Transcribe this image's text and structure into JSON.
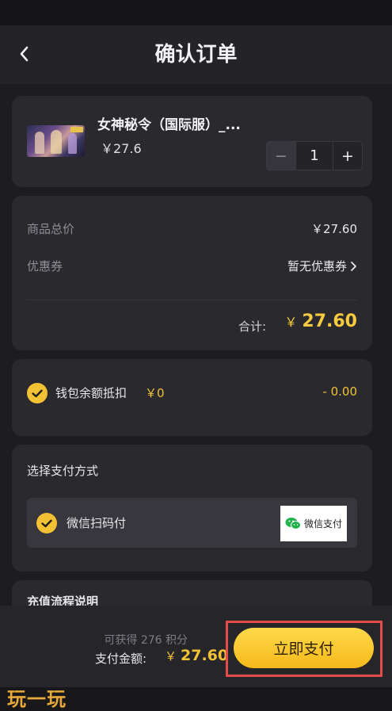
{
  "header": {
    "title": "确认订单",
    "back_icon": "chevron-left-icon"
  },
  "product": {
    "name": "女神秘令（国际服）_...",
    "price": "￥27.6",
    "quantity": "1",
    "minus_label": "−",
    "plus_label": "+"
  },
  "summary": {
    "total_label": "商品总价",
    "total_value": "￥27.60",
    "coupon_label": "优惠券",
    "coupon_value": "暂无优惠券",
    "subtotal_label": "合计:",
    "subtotal_currency": "￥",
    "subtotal_value": "27.60"
  },
  "wallet": {
    "label": "钱包余额抵扣",
    "balance": "￥0",
    "deduction": "- 0.00",
    "checked": true
  },
  "payment": {
    "section_title": "选择支付方式",
    "method_label": "微信扫码付",
    "logo_text": "微信支付",
    "checked": true
  },
  "flow": {
    "title": "充值流程说明"
  },
  "bottom": {
    "points_text": "可获得 276 积分",
    "pay_label": "支付金额:",
    "pay_currency": "￥",
    "pay_amount": "27.60",
    "pay_button": "立即支付"
  },
  "watermark": "玩一玩",
  "colors": {
    "accent": "#f3c134",
    "highlight_frame": "#e24b4b",
    "background": "#1d1d21",
    "card": "#29292e"
  }
}
